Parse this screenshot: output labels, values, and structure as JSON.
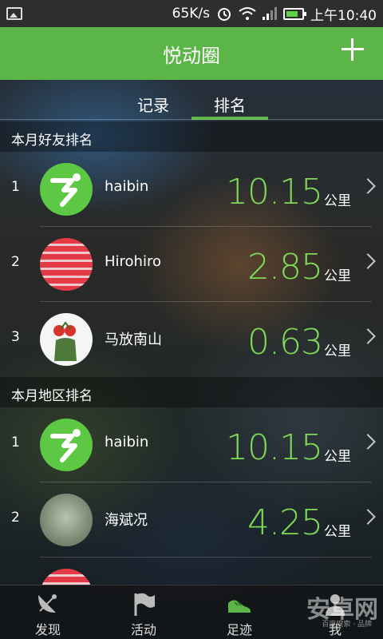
{
  "status_bar": {
    "speed": "65K/s",
    "time": "上午10:40",
    "icons": [
      "image-icon",
      "alarm-icon",
      "wifi-icon",
      "signal-icon",
      "battery-icon"
    ]
  },
  "header": {
    "title": "悦动圈",
    "add_icon": "plus-icon"
  },
  "tabs": [
    {
      "label": "记录",
      "active": false
    },
    {
      "label": "排名",
      "active": true
    }
  ],
  "friends": {
    "title": "本月好友排名",
    "rows": [
      {
        "rank": "1",
        "name": "haibin",
        "distance": "10.15",
        "unit": "公里"
      },
      {
        "rank": "2",
        "name": "Hirohiro",
        "distance": "2.85",
        "unit": "公里"
      },
      {
        "rank": "3",
        "name": "马放南山",
        "distance": "0.63",
        "unit": "公里"
      }
    ]
  },
  "region": {
    "title": "本月地区排名",
    "rows": [
      {
        "rank": "1",
        "name": "haibin",
        "distance": "10.15",
        "unit": "公里"
      },
      {
        "rank": "2",
        "name": "海斌况",
        "distance": "4.25",
        "unit": "公里"
      }
    ]
  },
  "bottom_nav": [
    {
      "label": "发现",
      "icon": "satellite-dish-icon"
    },
    {
      "label": "活动",
      "icon": "flag-icon"
    },
    {
      "label": "足迹",
      "icon": "shoe-icon"
    },
    {
      "label": "我",
      "icon": "person-icon"
    }
  ],
  "watermark": {
    "text": "安卓网",
    "sub": "百度搜索 · 品牌"
  },
  "colors": {
    "accent": "#5cb547",
    "distance": "#7ed957"
  }
}
